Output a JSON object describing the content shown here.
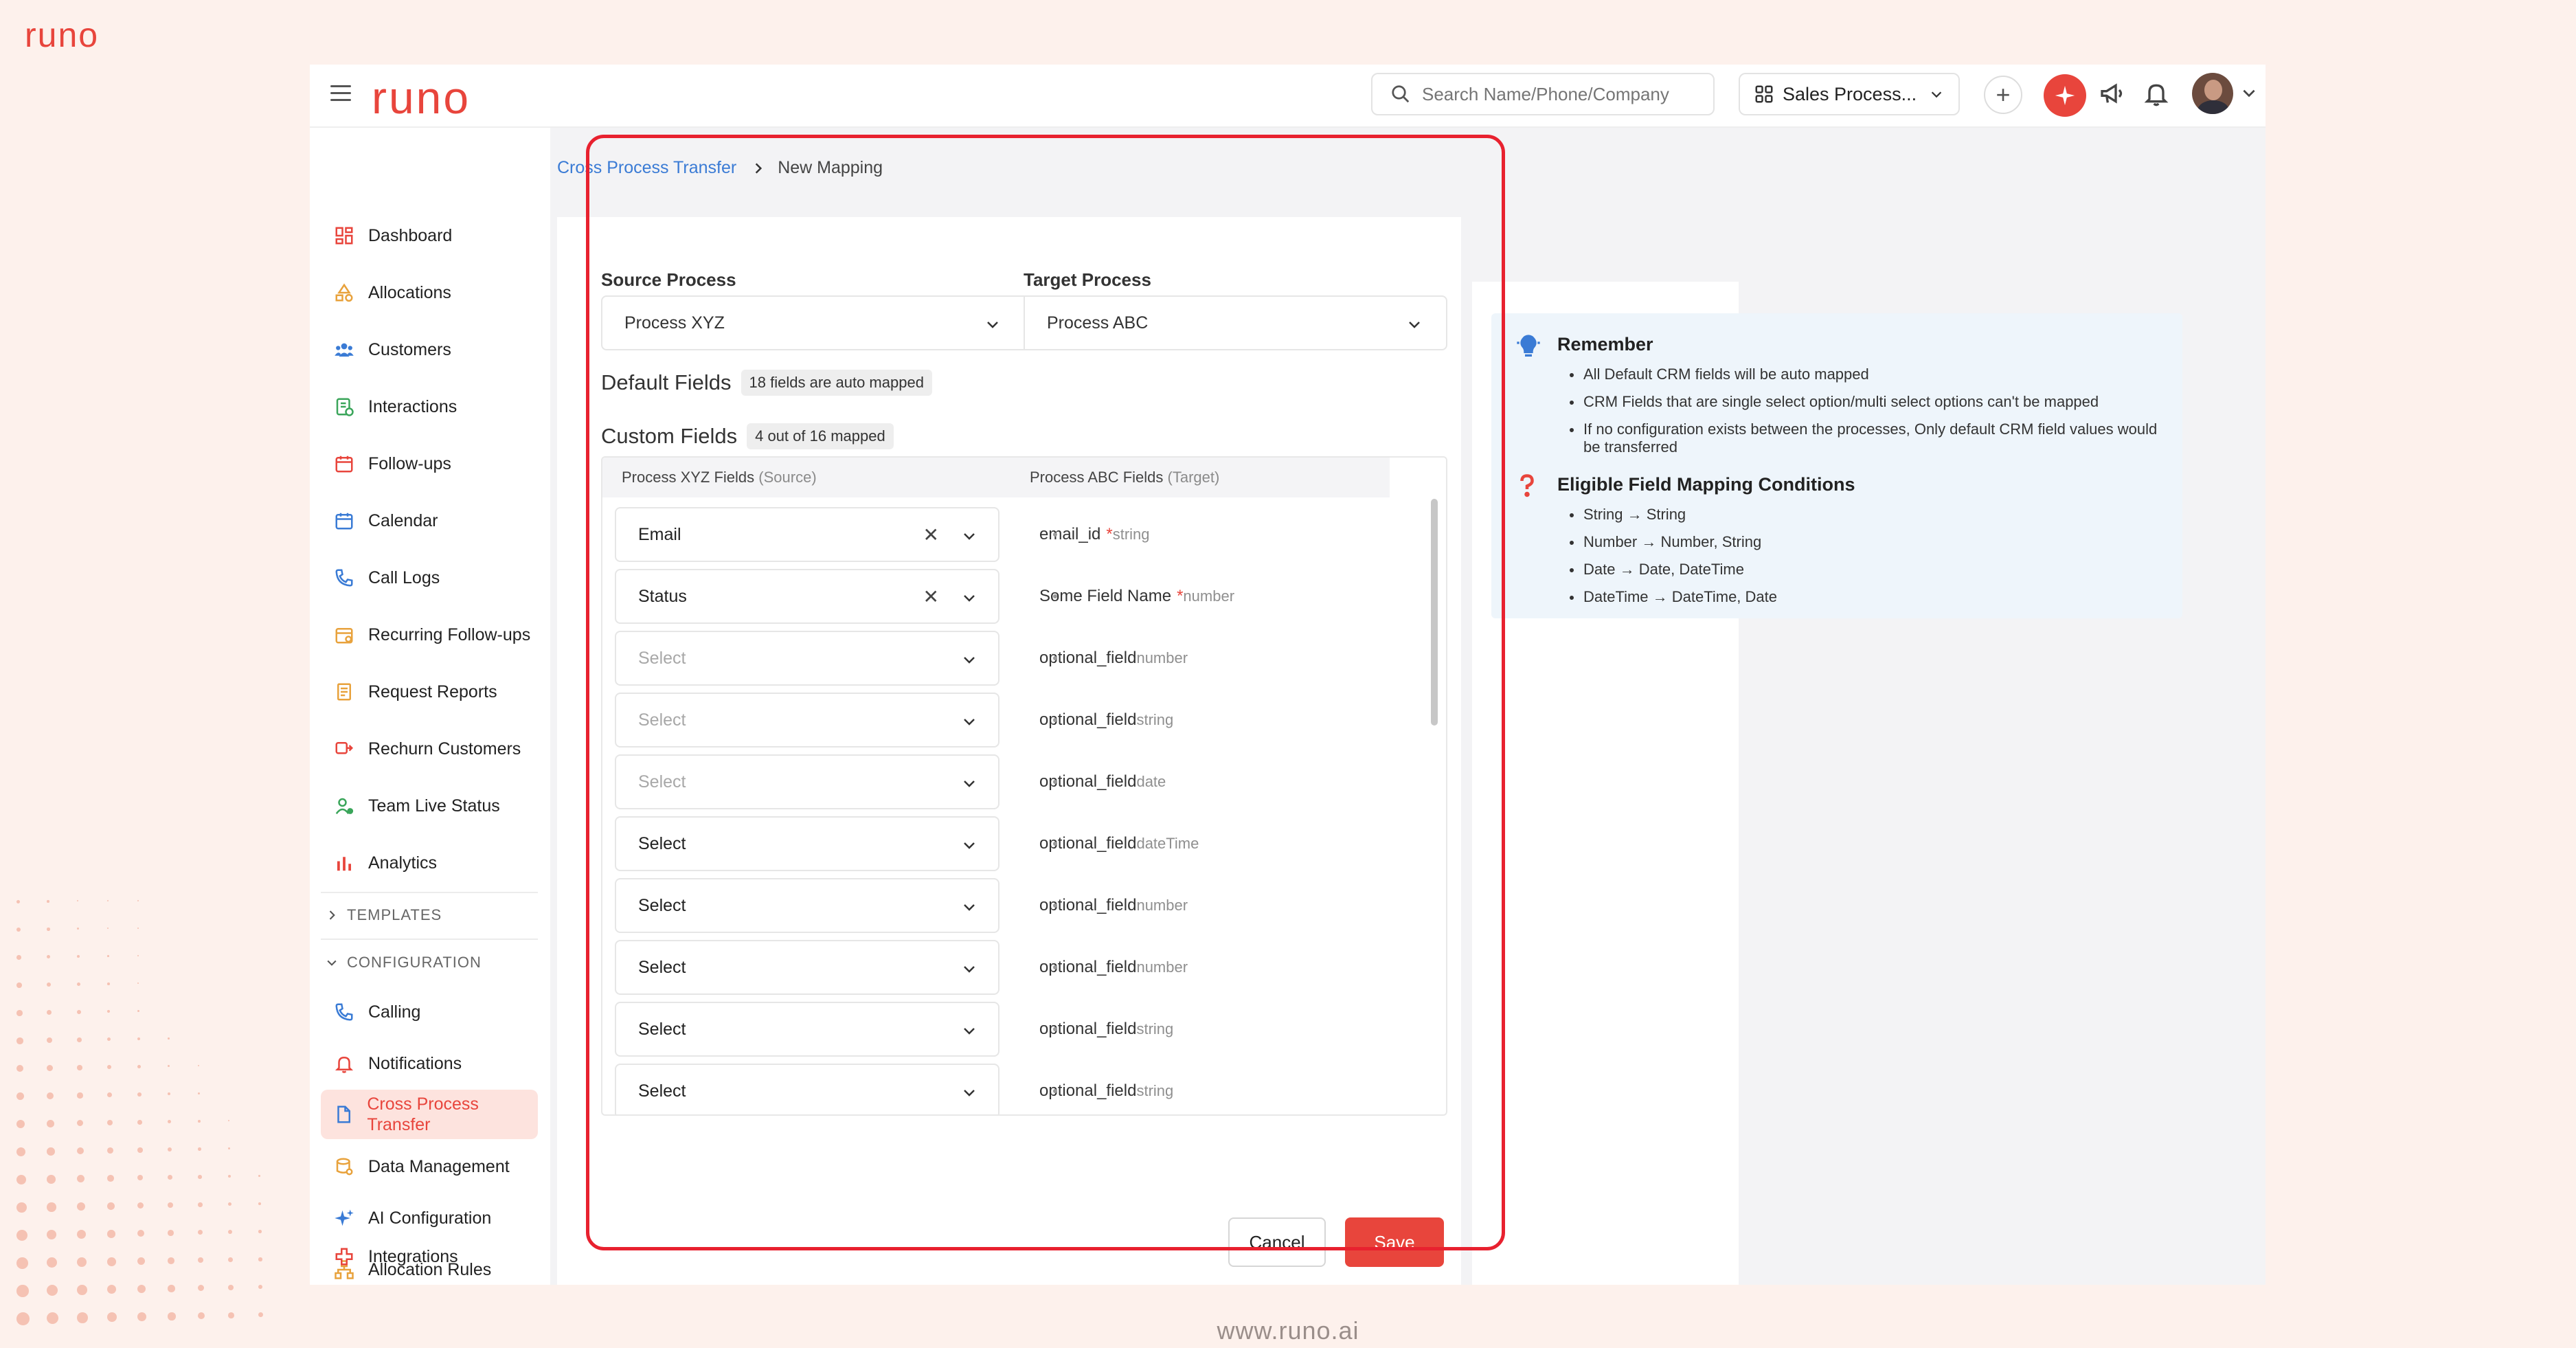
{
  "brand": {
    "logo_text": "runo",
    "footer_url": "www.runo.ai"
  },
  "topbar": {
    "search_placeholder": "Search Name/Phone/Company",
    "process_switch_label": "Sales Process...",
    "plus_label": "+"
  },
  "sidebar": {
    "items": [
      {
        "label": "Dashboard",
        "icon": "dashboard-icon"
      },
      {
        "label": "Allocations",
        "icon": "allocations-icon"
      },
      {
        "label": "Customers",
        "icon": "customers-icon"
      },
      {
        "label": "Interactions",
        "icon": "interactions-icon"
      },
      {
        "label": "Follow-ups",
        "icon": "follow-ups-icon"
      },
      {
        "label": "Calendar",
        "icon": "calendar-icon"
      },
      {
        "label": "Call Logs",
        "icon": "call-logs-icon"
      },
      {
        "label": "Recurring Follow-ups",
        "icon": "recurring-icon"
      },
      {
        "label": "Request Reports",
        "icon": "reports-icon"
      },
      {
        "label": "Rechurn Customers",
        "icon": "rechurn-icon"
      },
      {
        "label": "Team Live Status",
        "icon": "team-status-icon"
      },
      {
        "label": "Analytics",
        "icon": "analytics-icon"
      }
    ],
    "section_templates": "TEMPLATES",
    "section_configuration": "CONFIGURATION",
    "config_items": [
      {
        "label": "Calling",
        "icon": "calling-icon"
      },
      {
        "label": "Notifications",
        "icon": "notifications-icon"
      },
      {
        "label": "Cross Process Transfer",
        "icon": "transfer-icon",
        "active": true
      },
      {
        "label": "Data Management",
        "icon": "data-management-icon"
      },
      {
        "label": "AI Configuration",
        "icon": "ai-config-icon"
      },
      {
        "label": "Allocation Rules",
        "icon": "allocation-rules-icon"
      },
      {
        "label": "Integrations",
        "icon": "integrations-icon"
      }
    ]
  },
  "breadcrumb": {
    "parent": "Cross Process Transfer",
    "current": "New Mapping"
  },
  "form": {
    "source_label": "Source Process",
    "source_value": "Process XYZ",
    "target_label": "Target Process",
    "target_value": "Process ABC",
    "default_fields_title": "Default Fields",
    "default_fields_badge": "18 fields are auto mapped",
    "custom_fields_title": "Custom Fields",
    "custom_fields_badge": "4 out of 16 mapped",
    "table_header_source": "Process XYZ Fields",
    "table_header_source_hint": "(Source)",
    "table_header_target": "Process ABC Fields",
    "table_header_target_hint": "(Target)",
    "rows": [
      {
        "source": "Email",
        "placeholder": false,
        "clearable": true,
        "target": "email_id",
        "required": true,
        "type": "string"
      },
      {
        "source": "Status",
        "placeholder": false,
        "clearable": true,
        "target": "Some Field Name",
        "required": true,
        "type": "number"
      },
      {
        "source": "Select",
        "placeholder": true,
        "clearable": false,
        "target": "optional_field",
        "required": false,
        "type": "number"
      },
      {
        "source": "Select",
        "placeholder": true,
        "clearable": false,
        "target": "optional_field",
        "required": false,
        "type": "string"
      },
      {
        "source": "Select",
        "placeholder": true,
        "clearable": false,
        "target": "optional_field",
        "required": false,
        "type": "date"
      },
      {
        "source": "Select",
        "placeholder": false,
        "clearable": false,
        "target": "optional_field",
        "required": false,
        "type": "dateTime"
      },
      {
        "source": "Select",
        "placeholder": false,
        "clearable": false,
        "target": "optional_field",
        "required": false,
        "type": "number"
      },
      {
        "source": "Select",
        "placeholder": false,
        "clearable": false,
        "target": "optional_field",
        "required": false,
        "type": "number"
      },
      {
        "source": "Select",
        "placeholder": false,
        "clearable": false,
        "target": "optional_field",
        "required": false,
        "type": "string"
      },
      {
        "source": "Select",
        "placeholder": false,
        "clearable": false,
        "target": "optional_field",
        "required": false,
        "type": "string"
      }
    ],
    "cancel_label": "Cancel",
    "save_label": "Save"
  },
  "info": {
    "remember_title": "Remember",
    "remember_items": [
      "All Default CRM fields will be auto mapped",
      "CRM Fields that are single select option/multi select options can't be mapped",
      "If no configuration exists between the processes, Only default CRM field values would be transferred"
    ],
    "conditions_title": "Eligible Field Mapping Conditions",
    "condition_items": [
      "String → String",
      "Number → Number, String",
      "Date → Date, DateTime",
      "DateTime → DateTime, Date"
    ]
  },
  "colors": {
    "accent": "#e8453c",
    "link": "#3a7bd5",
    "highlight_border": "#e8212f",
    "info_bg": "#eef5fb"
  }
}
